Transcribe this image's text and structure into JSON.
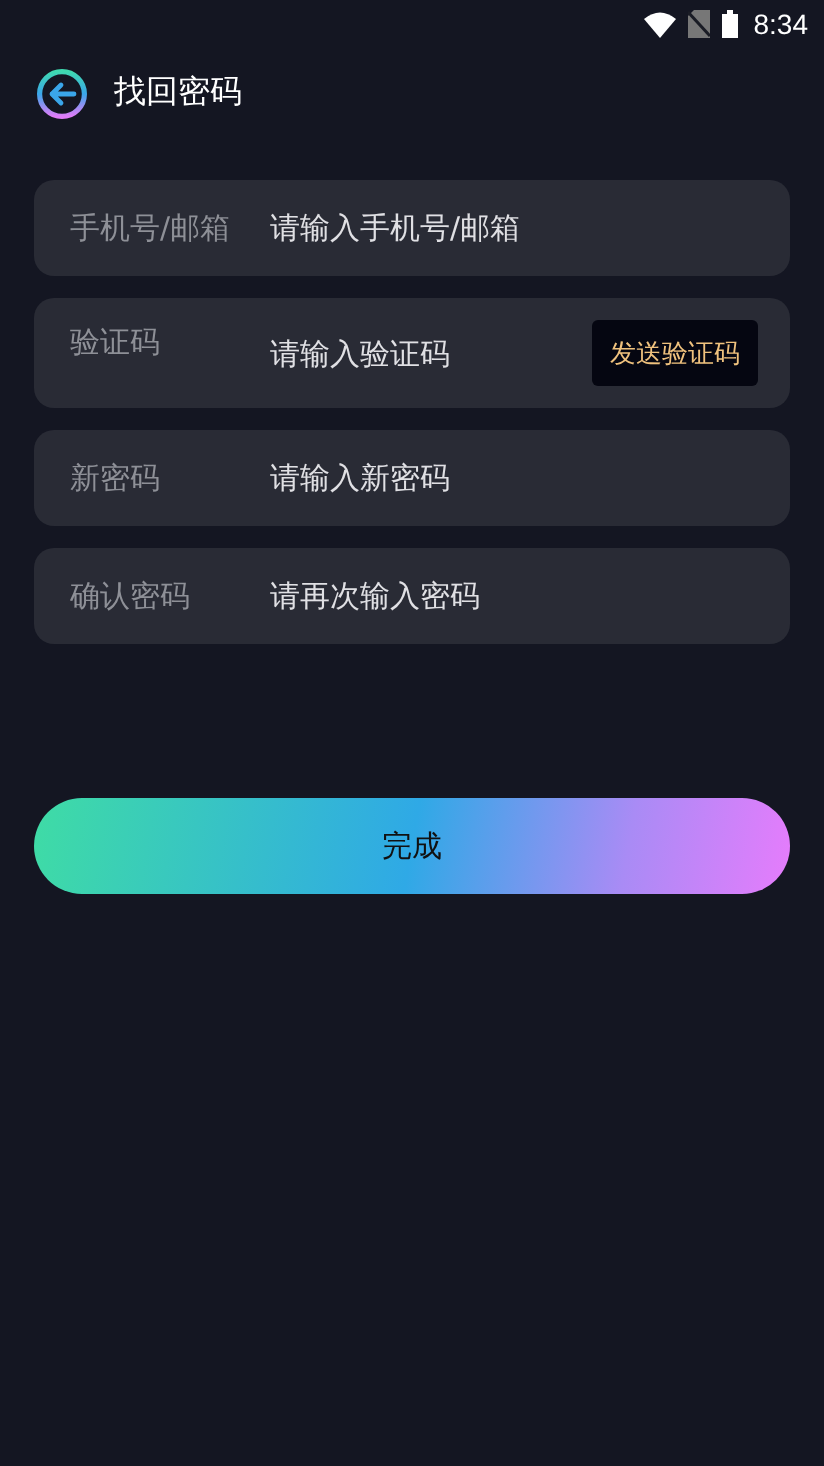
{
  "status_bar": {
    "time": "8:34"
  },
  "header": {
    "title": "找回密码"
  },
  "fields": [
    {
      "kind": "plain",
      "label": "手机号/邮箱",
      "placeholder": "请输入手机号/邮箱"
    },
    {
      "kind": "code",
      "label": "验证码",
      "placeholder": "请输入验证码",
      "button": "发送验证码"
    },
    {
      "kind": "plain",
      "label": "新密码",
      "placeholder": "请输入新密码"
    },
    {
      "kind": "plain",
      "label": "确认密码",
      "placeholder": "请再次输入密码"
    }
  ],
  "submit": {
    "label": "完成"
  }
}
